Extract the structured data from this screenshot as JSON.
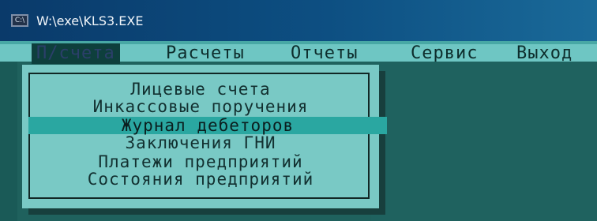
{
  "window": {
    "title": "W:\\exe\\KLS3.EXE",
    "icon_text": "C:\\"
  },
  "menubar": {
    "items": [
      {
        "label": "П/счета",
        "active": true
      },
      {
        "label": "Расчеты",
        "active": false
      },
      {
        "label": "Отчеты",
        "active": false
      },
      {
        "label": "Сервис",
        "active": false
      },
      {
        "label": "Выход",
        "active": false
      }
    ]
  },
  "dropdown": {
    "items": [
      {
        "label": "Лицевые счета",
        "selected": false
      },
      {
        "label": "Инкассовые поручения",
        "selected": false
      },
      {
        "label": "Журнал дебеторов",
        "selected": true
      },
      {
        "label": "Заключения ГНИ",
        "selected": false
      },
      {
        "label": "Платежи предприятий",
        "selected": false
      },
      {
        "label": "Состояния предприятий",
        "selected": false
      }
    ]
  },
  "colors": {
    "menubar_bg": "#6ec6c3",
    "dropdown_bg": "#79c9c5",
    "selected_bg": "#2aa7a1",
    "desktop_bg": "#1f615d"
  }
}
